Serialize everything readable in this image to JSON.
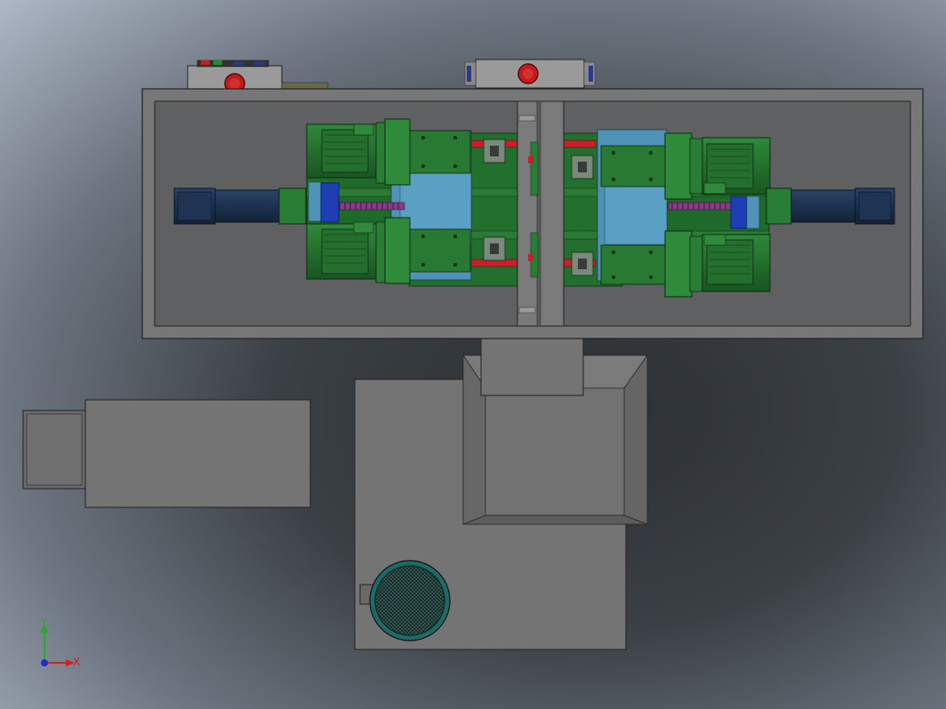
{
  "viewport": {
    "background_inner": "#34383b",
    "background_outer": "#b4bfcd"
  },
  "model": {
    "frame_color": "#747474",
    "frame_inner_color": "#5f6061",
    "motor_green": "#2a7d34",
    "motor_green_dark": "#1c5a24",
    "servo_navy": "#1f3452",
    "plate_blue": "#4f93b8",
    "block_blue": "#1e3fb4",
    "rail_red": "#c8202a",
    "stop_button_red": "#c41a1a"
  },
  "triad": {
    "x_label": "X",
    "y_label": "Y",
    "x_color": "#d02020",
    "y_color": "#20b020",
    "z_color": "#2030c0"
  }
}
